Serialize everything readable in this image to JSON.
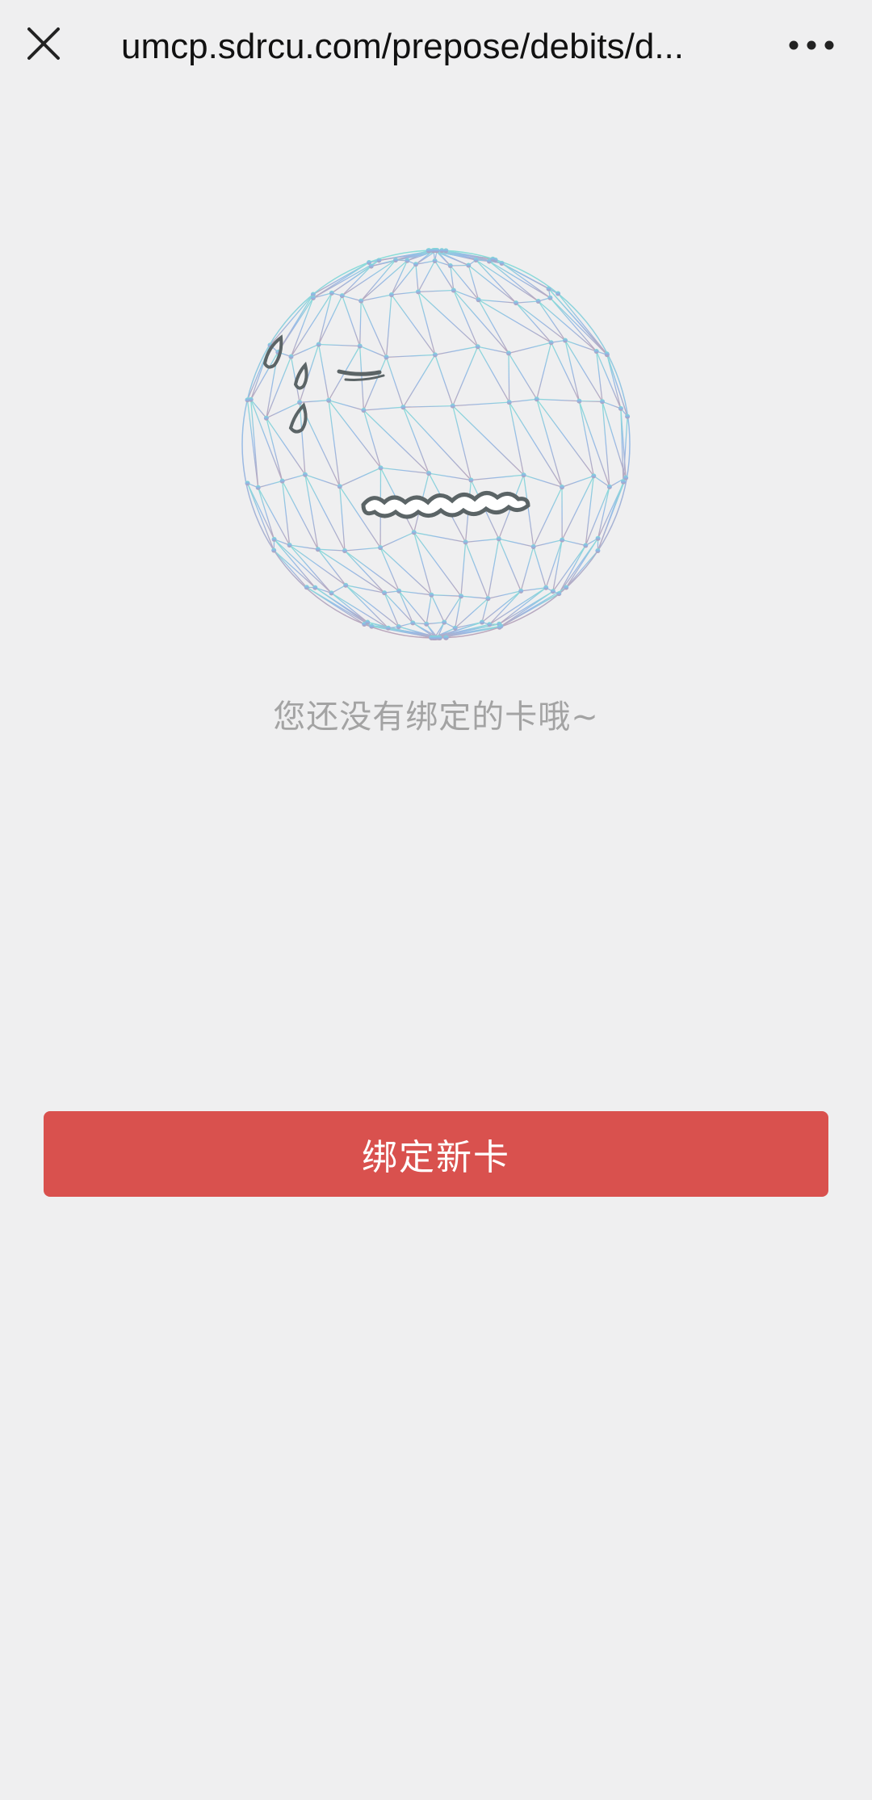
{
  "top_bar": {
    "close_icon": "close-icon",
    "url": "umcp.sdrcu.com/prepose/debits/d...",
    "more_icon": "more-dots-icon"
  },
  "illustration": {
    "icon": "crying-wireframe-sphere-icon",
    "colors": {
      "top": "#7fdcd6",
      "middle": "#8fb6e6",
      "bottom": "#b79fb5",
      "face": "#5b6466"
    }
  },
  "main": {
    "empty_message": "您还没有绑定的卡哦~",
    "bind_button_label": "绑定新卡",
    "bind_button_color": "#d9514e"
  }
}
